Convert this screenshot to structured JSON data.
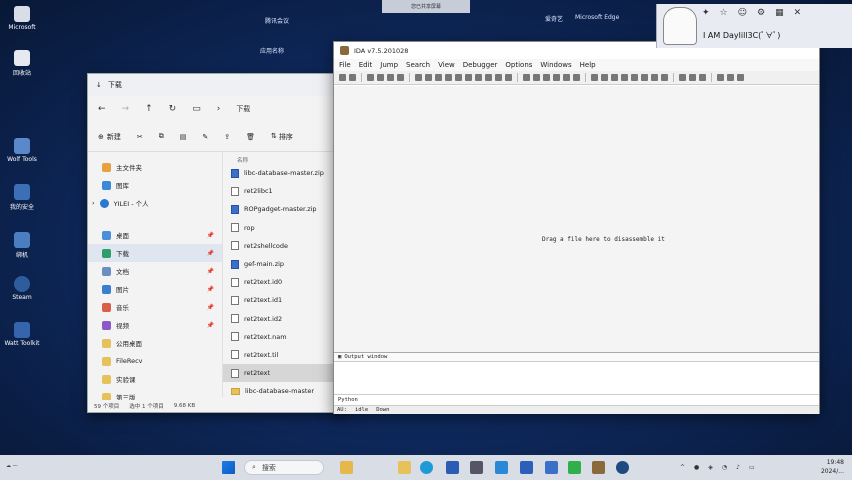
{
  "desktop": {
    "icons": [
      {
        "label": "Microsoft"
      },
      {
        "label": "回收站"
      },
      {
        "label": "Wolf Tools"
      },
      {
        "label": "我的安全"
      },
      {
        "label": "绑机"
      },
      {
        "label": "Steam"
      },
      {
        "label": "Watt Toolkit"
      }
    ],
    "top_labels": [
      "腾讯会议",
      "应用名称",
      "爱奇艺",
      "Microsoft Edge"
    ],
    "banner": "您已共享屏幕"
  },
  "explorer": {
    "tab_title": "下载",
    "address": "下载",
    "new_label": "新建",
    "sort_label": "排序",
    "sidebar": [
      {
        "label": "主文件夹"
      },
      {
        "label": "图库"
      },
      {
        "label": "YILEI - 个人"
      },
      {
        "label": "桌面"
      },
      {
        "label": "下载"
      },
      {
        "label": "文档"
      },
      {
        "label": "图片"
      },
      {
        "label": "音乐"
      },
      {
        "label": "视频"
      },
      {
        "label": "公用桌面"
      },
      {
        "label": "FileRecv"
      },
      {
        "label": "实验课"
      },
      {
        "label": "第三版"
      }
    ],
    "column_header": "名称",
    "files": [
      {
        "name": "libc-database-master.zip",
        "type": "zip"
      },
      {
        "name": "ret2libc1",
        "type": "file"
      },
      {
        "name": "ROPgadget-master.zip",
        "type": "zip"
      },
      {
        "name": "rop",
        "type": "file"
      },
      {
        "name": "ret2shellcode",
        "type": "file"
      },
      {
        "name": "gef-main.zip",
        "type": "zip"
      },
      {
        "name": "ret2text.id0",
        "type": "file"
      },
      {
        "name": "ret2text.id1",
        "type": "file"
      },
      {
        "name": "ret2text.id2",
        "type": "file"
      },
      {
        "name": "ret2text.nam",
        "type": "file"
      },
      {
        "name": "ret2text.til",
        "type": "file"
      },
      {
        "name": "ret2text",
        "type": "file"
      },
      {
        "name": "libc-database-master",
        "type": "folder"
      }
    ],
    "status": {
      "count": "59 个项目",
      "selected": "选中 1 个项目",
      "size": "9.68 KB"
    }
  },
  "ida": {
    "title": "IDA v7.5.201028",
    "menu": [
      "File",
      "Edit",
      "Jump",
      "Search",
      "View",
      "Debugger",
      "Options",
      "Windows",
      "Help"
    ],
    "drag_message": "Drag a file here to disassemble it",
    "output_title": "Output window",
    "python_label": "Python",
    "status": {
      "au": "AU:",
      "idle": "idle",
      "down": "Down"
    }
  },
  "overlay": {
    "text": "I AM Daylill3C(ﾟ∀ﾟ)"
  },
  "taskbar": {
    "search": "搜索",
    "time": "19:48",
    "date": "2024/..."
  },
  "colors": {
    "desktop_bg": "#0f2a60",
    "selection": "#dfe6ef",
    "accent": "#0a5cc4"
  }
}
